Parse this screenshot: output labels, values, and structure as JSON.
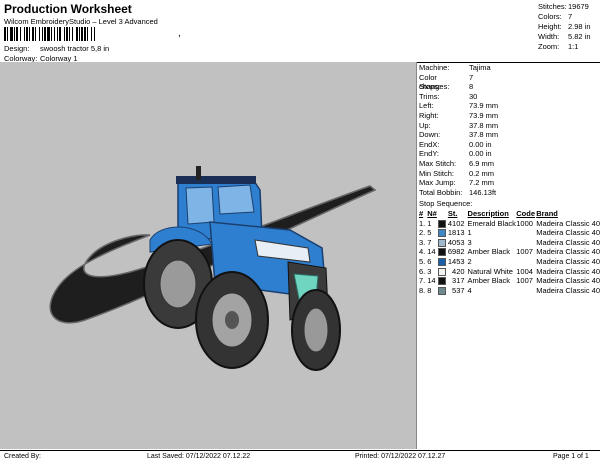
{
  "header": {
    "title": "Production Worksheet",
    "subtitle": "Wilcom EmbroideryStudio – Level 3 Advanced",
    "barcode_suffix": ","
  },
  "top_stats": [
    {
      "label": "Stitches:",
      "value": "19679"
    },
    {
      "label": "Colors:",
      "value": "7"
    },
    {
      "label": "Height:",
      "value": "2.98 in"
    },
    {
      "label": "Width:",
      "value": "5.82 in"
    },
    {
      "label": "Zoom:",
      "value": "1:1"
    }
  ],
  "design": {
    "label": "Design:",
    "value": "swoosh tractor 5,8 in"
  },
  "colorway": {
    "label": "Colorway:",
    "value": "Colorway 1"
  },
  "machine_info": [
    {
      "label": "Machine:",
      "value": "Tajima"
    },
    {
      "label": "Color changes:",
      "value": "7"
    },
    {
      "label": "Stops:",
      "value": "8"
    },
    {
      "label": "Trims:",
      "value": "30"
    },
    {
      "label": "Left:",
      "value": "73.9 mm"
    },
    {
      "label": "Right:",
      "value": "73.9 mm"
    },
    {
      "label": "Up:",
      "value": "37.8 mm"
    },
    {
      "label": "Down:",
      "value": "37.8 mm"
    },
    {
      "label": "EndX:",
      "value": "0.00 in"
    },
    {
      "label": "EndY:",
      "value": "0.00 in"
    },
    {
      "label": "Max Stitch:",
      "value": "6.9 mm"
    },
    {
      "label": "Min Stitch:",
      "value": "0.2 mm"
    },
    {
      "label": "Max Jump:",
      "value": "7.2 mm"
    },
    {
      "label": "Total Bobbin:",
      "value": "146.13ft"
    }
  ],
  "stop_sequence": {
    "heading": "Stop Sequence:",
    "columns": {
      "stop": "#",
      "n": "N#",
      "st": "St.",
      "description": "Description",
      "code": "Code",
      "brand": "Brand"
    },
    "rows": [
      {
        "stop": "1.",
        "n": "1",
        "color": "#111111",
        "st": "4102",
        "description": "Emerald Black",
        "code": "1000",
        "brand": "Madeira Classic 40"
      },
      {
        "stop": "2.",
        "n": "5",
        "color": "#3d86c8",
        "st": "1813",
        "description": "1",
        "code": "",
        "brand": "Madeira Classic 40"
      },
      {
        "stop": "3.",
        "n": "7",
        "color": "#9fb9cf",
        "st": "4053",
        "description": "3",
        "code": "",
        "brand": "Madeira Classic 40"
      },
      {
        "stop": "4.",
        "n": "14",
        "color": "#111111",
        "st": "6982",
        "description": "Amber Black",
        "code": "1007",
        "brand": "Madeira Classic 40"
      },
      {
        "stop": "5.",
        "n": "6",
        "color": "#1a5fa8",
        "st": "1453",
        "description": "2",
        "code": "",
        "brand": "Madeira Classic 40"
      },
      {
        "stop": "6.",
        "n": "3",
        "color": "#f3f3f3",
        "st": "420",
        "description": "Natural White",
        "code": "1004",
        "brand": "Madeira Classic 40"
      },
      {
        "stop": "7.",
        "n": "14",
        "color": "#111111",
        "st": "317",
        "description": "Amber Black",
        "code": "1007",
        "brand": "Madeira Classic 40"
      },
      {
        "stop": "8.",
        "n": "8",
        "color": "#6f8a8c",
        "st": "537",
        "description": "4",
        "code": "",
        "brand": "Madeira Classic 40"
      }
    ]
  },
  "footer": {
    "created_by": "Created By:",
    "last_saved": "Last Saved: 07/12/2022 07.12.22",
    "printed": "Printed: 07/12/2022 07.12.27",
    "page": "Page 1 of 1"
  },
  "colors": {
    "canvas_bg": "#c1c1c1",
    "tractor_blue": "#2f7fd0"
  }
}
